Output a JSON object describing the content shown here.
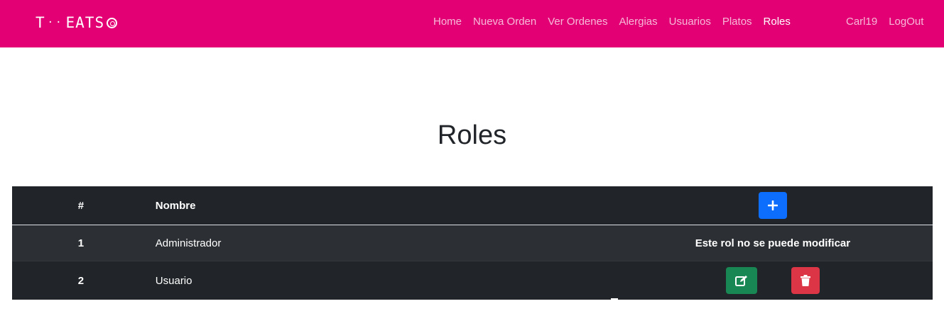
{
  "brand": {
    "left": "T",
    "dots": "··",
    "right": "EATS"
  },
  "nav": {
    "links": [
      {
        "label": "Home"
      },
      {
        "label": "Nueva Orden"
      },
      {
        "label": "Ver Ordenes"
      },
      {
        "label": "Alergias"
      },
      {
        "label": "Usuarios"
      },
      {
        "label": "Platos"
      },
      {
        "label": "Roles",
        "active": true
      }
    ],
    "user": "Carl19",
    "logout": "LogOut"
  },
  "page": {
    "title": "Roles"
  },
  "table": {
    "headers": {
      "num": "#",
      "name": "Nombre"
    },
    "add_icon": "plus-icon",
    "rows": [
      {
        "num": "1",
        "name": "Administrador",
        "locked_text": "Este rol no se puede modificar"
      },
      {
        "num": "2",
        "name": "Usuario",
        "edit_icon": "edit-icon",
        "delete_icon": "trash-icon"
      }
    ]
  },
  "colors": {
    "navbar": "#e20074",
    "table_dark": "#212529",
    "add": "#0d6efd",
    "edit": "#198754",
    "delete": "#dc3545"
  }
}
